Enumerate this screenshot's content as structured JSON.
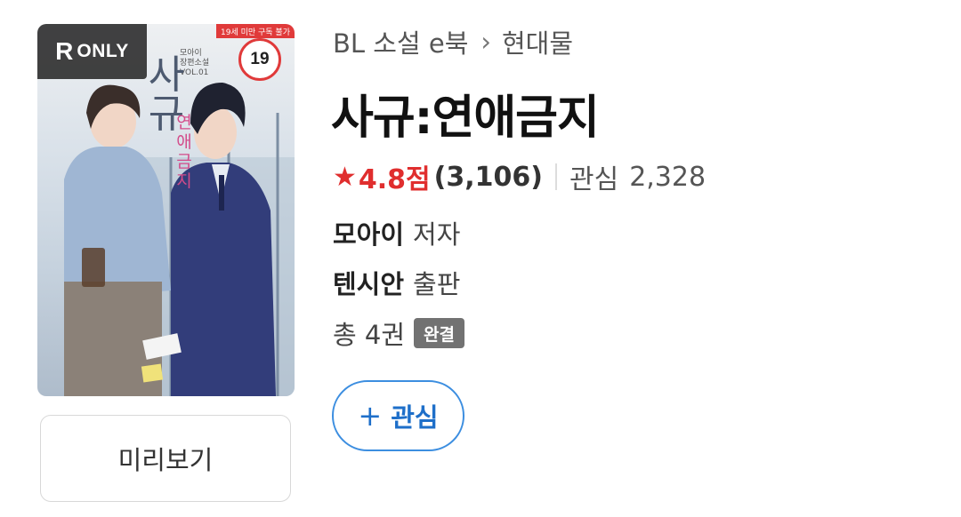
{
  "cover": {
    "badge_r": "R",
    "badge_only": "ONLY",
    "age_strip": "19세 미만 구독 불가",
    "age_badge": "19",
    "cover_author": "모아이",
    "cover_genre": "장편소설",
    "cover_vol": "VOL.01",
    "cover_title_big": "사규",
    "cover_title_sub": "연애금지"
  },
  "preview_button": {
    "label": "미리보기"
  },
  "breadcrumb": {
    "category": "BL 소설 e북",
    "separator": "›",
    "subcategory": "현대물"
  },
  "book": {
    "title": "사규:연애금지",
    "rating_star": "★",
    "rating": "4.8점",
    "rating_count": "(3,106)",
    "favorite_label": "관심",
    "favorite_count": "2,328",
    "author_name": "모아이",
    "author_role": "저자",
    "publisher_name": "텐시안",
    "publisher_role": "출판",
    "volumes": "총 4권",
    "status_badge": "완결"
  },
  "favorite_button": {
    "icon": "+",
    "label": "관심"
  },
  "colors": {
    "accent_red": "#e02e2e",
    "accent_blue": "#1e6fc9",
    "badge_gray": "#727272"
  }
}
